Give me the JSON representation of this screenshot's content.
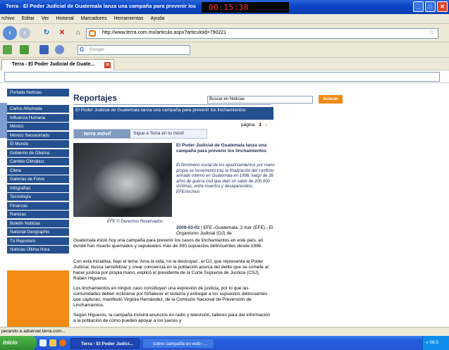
{
  "window": {
    "title": "Terra - El Poder Judicial de Guatemala lanza una campaña para prevenir los",
    "clock": "00:15:38"
  },
  "menu": [
    "rchivo",
    "Editar",
    "Ver",
    "Historial",
    "Marcadores",
    "Herramientas",
    "Ayuda"
  ],
  "navbar": {
    "url": "http://www.terra.com.mx/articulo.aspx?articuloId=790221",
    "search_placeholder": "Google"
  },
  "tab": {
    "label": "Terra - El Poder Judicial de Guate..."
  },
  "sidebar": {
    "items": [
      "Portada Noticias",
      "Carlos Ahumada",
      "Influenza Humana",
      "México",
      "México Secuestrado",
      "El Mundo",
      "Gobierno de Obama",
      "Cambio Climático",
      "Clima",
      "Galerías de Fotos",
      "Infografías",
      "Tecnología",
      "Finanzas",
      "Rarezas",
      "Boletín Noticias",
      "National Geographic",
      "Tú Reportero",
      "Noticias Última Hora"
    ]
  },
  "article": {
    "section_title": "Reportajes",
    "search_placeholder": "Buscar en Noticias",
    "search_button": "buscar",
    "banner": "El Poder Judicial de Guatemala lanza una campaña para prevenir los linchamientos",
    "page_label": "página",
    "page_current": "1",
    "page_next": "»",
    "promo_logo": "terra móvil",
    "promo_text": "Sigue a Terra en tu móvil",
    "photo_credit": "EFE © Derechos Reservados",
    "caption_title": "El Poder Judicial de Guatemala lanza una campaña para prevenir los linchamientos",
    "caption_body": "El fenómeno social de los ajusticiamientos por mano propia se incrementó tras la finalización del conflicto armado interno en Guatemala en 1996, luego de 36 años de guerra civil que dejó un saldo de 200.000 víctimas, entre muertos y desaparecidos. EFE/Archivo",
    "date": "2009-03-02",
    "dateline": "| EFE.-Guatemala, 2 mar (EFE).- El Organismo Judicial (OJ) de",
    "paragraphs": [
      "Guatemala inició hoy una campaña para prevenir los casos de linchamientos en este país, en donde han muerto quemados y vapuleados más de 300 supuestos delincuentes desde 1996.",
      "Con esta iniciativa, bajo el lema 'Ama la vida, no la destruyas', el OJ, que representa al Poder Judicial, busca sensibilizar y crear conciencia en la población acerca del delito que se comete al hacer justicia por propia mano, explicó el presidente de la Corte Suprema de Justicia (CSJ), Rubén Higueros.",
      "Los linchamientos en ningún caso constituyen una expresión de justicia, por lo que las comunidades deben inclinarse por fortalecer el sistema y entregar a los supuestos delincuentes que capturan, manifestó Virginia Hernández, de la Comisión Nacional de Prevención de Linchamientos.",
      "Según Higueros, la campaña incluirá anuncios en radio y televisión, talleres para dar información a la población de cómo pueden apoyar a los jueces y"
    ]
  },
  "status": "perando a adserver.terra.com...",
  "taskbar": {
    "start": "inicio",
    "task1": "Terra - El Poder Judici...",
    "task2": "sobre campaña en web -...",
    "tray_time": "« 06:5"
  }
}
